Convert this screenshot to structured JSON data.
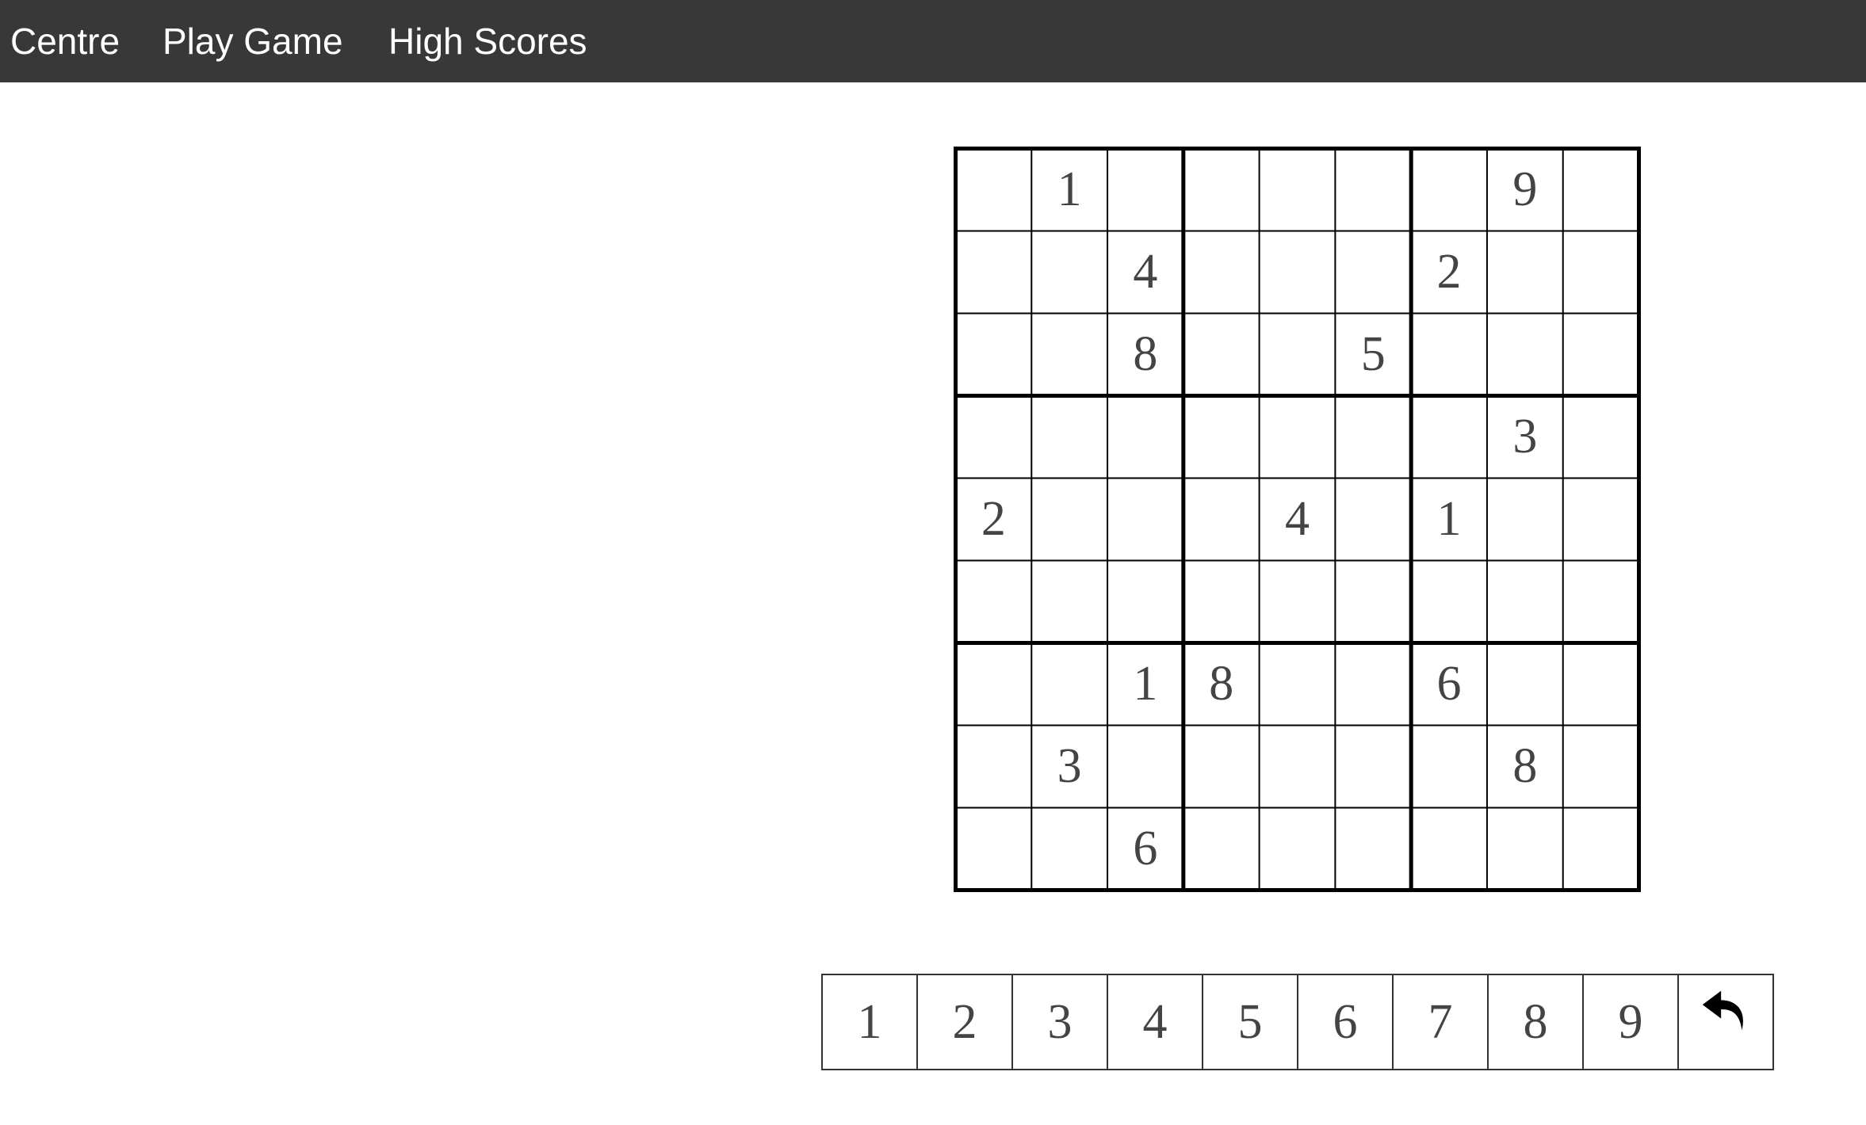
{
  "nav": {
    "items": [
      {
        "label": "Centre"
      },
      {
        "label": "Play Game"
      },
      {
        "label": "High Scores"
      }
    ]
  },
  "board": {
    "grid": [
      [
        "",
        "1",
        "",
        "",
        "",
        "",
        "",
        "9",
        ""
      ],
      [
        "",
        "",
        "4",
        "",
        "",
        "",
        "2",
        "",
        ""
      ],
      [
        "",
        "",
        "8",
        "",
        "",
        "5",
        "",
        "",
        ""
      ],
      [
        "",
        "",
        "",
        "",
        "",
        "",
        "",
        "3",
        ""
      ],
      [
        "2",
        "",
        "",
        "",
        "4",
        "",
        "1",
        "",
        ""
      ],
      [
        "",
        "",
        "",
        "",
        "",
        "",
        "",
        "",
        ""
      ],
      [
        "",
        "",
        "1",
        "8",
        "",
        "",
        "6",
        "",
        ""
      ],
      [
        "",
        "3",
        "",
        "",
        "",
        "",
        "",
        "8",
        ""
      ],
      [
        "",
        "",
        "6",
        "",
        "",
        "",
        "",
        "",
        ""
      ]
    ]
  },
  "numpad": {
    "keys": [
      "1",
      "2",
      "3",
      "4",
      "5",
      "6",
      "7",
      "8",
      "9"
    ],
    "undo_icon": "undo-arrow-icon"
  },
  "colors": {
    "navbar_bg": "#383838",
    "nav_text": "#ffffff",
    "digit_text": "#444444",
    "grid_line": "#000000"
  }
}
